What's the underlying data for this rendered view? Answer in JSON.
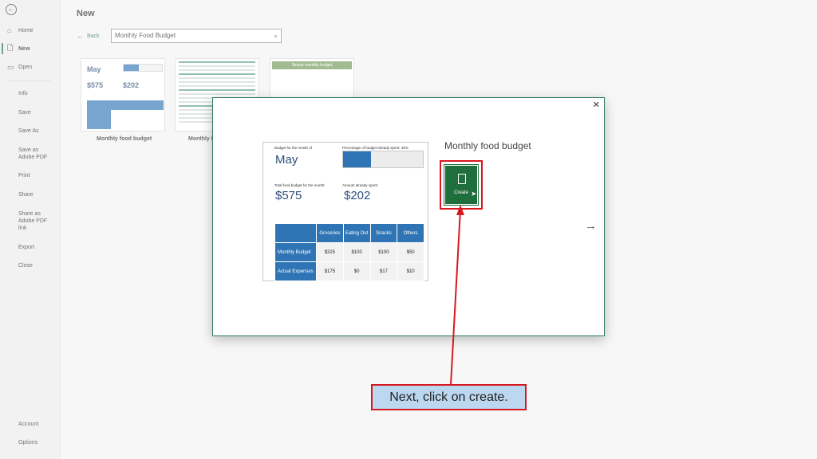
{
  "sidebar": {
    "items": [
      {
        "label": "Home",
        "icon": "home-icon"
      },
      {
        "label": "New",
        "icon": "new-file-icon",
        "active": true
      },
      {
        "label": "Open",
        "icon": "folder-icon"
      },
      {
        "label": "Info"
      },
      {
        "label": "Save"
      },
      {
        "label": "Save As"
      },
      {
        "label": "Save as Adobe PDF"
      },
      {
        "label": "Print"
      },
      {
        "label": "Share"
      },
      {
        "label": "Share as Adobe PDF link"
      },
      {
        "label": "Export"
      },
      {
        "label": "Close"
      },
      {
        "label": "Account"
      },
      {
        "label": "Options"
      }
    ]
  },
  "header": {
    "title": "New",
    "back_label": "Back",
    "search_value": "Monthly Food Budget"
  },
  "templates": [
    {
      "label": "Monthly food budget"
    },
    {
      "label": "Monthly b"
    },
    {
      "label": "Simple monthly budget"
    }
  ],
  "thumb1": {
    "month": "May",
    "total": "$575",
    "spent": "$202"
  },
  "modal": {
    "title": "Monthly food budget",
    "create_label": "Create",
    "preview": {
      "budget_month_label": "Budget for the month of",
      "month": "May",
      "percent_label": "Percentage of budget already spent:",
      "percent_value": "35%",
      "percent_fraction": 0.35,
      "total_label": "Total food budget for the month:",
      "total_value": "$575",
      "spent_label": "Amount already spent:",
      "spent_value": "$202",
      "table": {
        "headers": [
          "",
          "Groceries",
          "Eating Out",
          "Snacks",
          "Others"
        ],
        "rows": [
          [
            "Monthly Budget",
            "$325",
            "$100",
            "$100",
            "$50"
          ],
          [
            "Actual Expenses",
            "$175",
            "$0",
            "$17",
            "$10"
          ]
        ]
      }
    }
  },
  "annotation": {
    "text": "Next, click on create."
  },
  "colors": {
    "accent": "#217346",
    "create": "#1e6f3c",
    "highlight": "#d7191f",
    "table_blue": "#2f75b5"
  }
}
